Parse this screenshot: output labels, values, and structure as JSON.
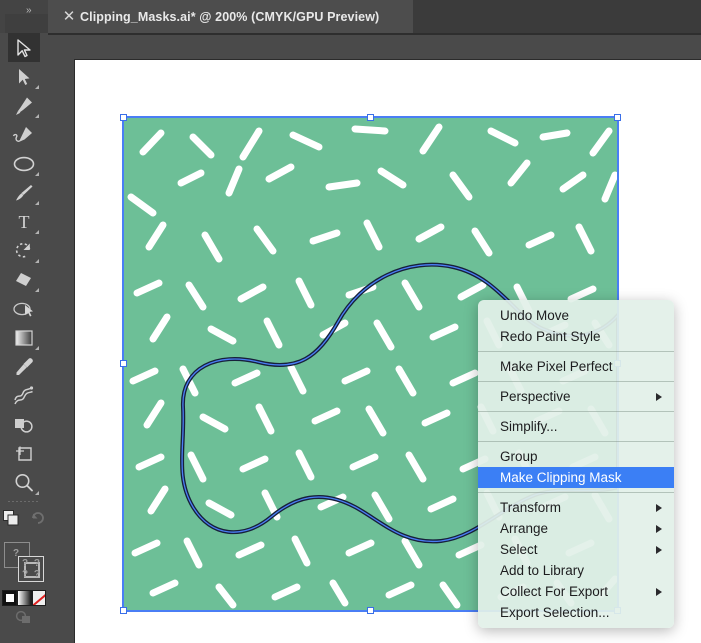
{
  "window": {
    "tab_close_icon": "close-icon",
    "tab_title": "Clipping_Masks.ai* @ 200% (CMYK/GPU Preview)",
    "panel_expand_icon": "»"
  },
  "toolbar": {
    "tools": [
      {
        "name": "selection-tool",
        "label": "Selection",
        "active": true,
        "has_flyout": false
      },
      {
        "name": "direct-selection-tool",
        "label": "Direct Selection",
        "active": false,
        "has_flyout": true
      },
      {
        "name": "pen-tool",
        "label": "Pen",
        "active": false,
        "has_flyout": true
      },
      {
        "name": "curvature-tool",
        "label": "Curvature",
        "active": false,
        "has_flyout": false
      },
      {
        "name": "ellipse-tool",
        "label": "Ellipse",
        "active": false,
        "has_flyout": true
      },
      {
        "name": "paintbrush-tool",
        "label": "Paintbrush",
        "active": false,
        "has_flyout": true
      },
      {
        "name": "type-tool",
        "label": "Type",
        "active": false,
        "has_flyout": true
      },
      {
        "name": "rotate-tool",
        "label": "Rotate",
        "active": false,
        "has_flyout": true
      },
      {
        "name": "eraser-tool",
        "label": "Eraser",
        "active": false,
        "has_flyout": true
      },
      {
        "name": "scale-shaper-tool",
        "label": "Shaper",
        "active": false,
        "has_flyout": false
      },
      {
        "name": "gradient-tool",
        "label": "Gradient",
        "active": false,
        "has_flyout": true
      },
      {
        "name": "eyedropper-tool",
        "label": "Eyedropper",
        "active": false,
        "has_flyout": false
      },
      {
        "name": "blend-tool",
        "label": "Blend",
        "active": false,
        "has_flyout": false
      },
      {
        "name": "shape-builder-tool",
        "label": "Shape Builder",
        "active": false,
        "has_flyout": false
      },
      {
        "name": "artboard-tool",
        "label": "Artboard",
        "active": false,
        "has_flyout": false
      },
      {
        "name": "zoom-tool",
        "label": "Zoom",
        "active": false,
        "has_flyout": true
      }
    ],
    "screen_mode_icon": "change-screen-mode-icon",
    "undo_icon": "undo-arrow-icon",
    "fill_label": "?",
    "stroke_label": "?",
    "color_modes": [
      "color",
      "gradient",
      "none"
    ],
    "drawing_mode_icon": "drawing-modes-icon"
  },
  "menu": {
    "items": [
      {
        "label": "Undo Move",
        "submenu": false,
        "selected": false,
        "separator_after": false
      },
      {
        "label": "Redo Paint Style",
        "submenu": false,
        "selected": false,
        "separator_after": true
      },
      {
        "label": "Make Pixel Perfect",
        "submenu": false,
        "selected": false,
        "separator_after": true
      },
      {
        "label": "Perspective",
        "submenu": true,
        "selected": false,
        "separator_after": true
      },
      {
        "label": "Simplify...",
        "submenu": false,
        "selected": false,
        "separator_after": true
      },
      {
        "label": "Group",
        "submenu": false,
        "selected": false,
        "separator_after": false
      },
      {
        "label": "Make Clipping Mask",
        "submenu": false,
        "selected": true,
        "separator_after": true
      },
      {
        "label": "Transform",
        "submenu": true,
        "selected": false,
        "separator_after": false
      },
      {
        "label": "Arrange",
        "submenu": true,
        "selected": false,
        "separator_after": false
      },
      {
        "label": "Select",
        "submenu": true,
        "selected": false,
        "separator_after": false
      },
      {
        "label": "Add to Library",
        "submenu": false,
        "selected": false,
        "separator_after": false
      },
      {
        "label": "Collect For Export",
        "submenu": true,
        "selected": false,
        "separator_after": false
      },
      {
        "label": "Export Selection...",
        "submenu": false,
        "selected": false,
        "separator_after": false
      }
    ]
  },
  "artwork": {
    "background_color": "#6dbf97",
    "dash_color": "#ffffff",
    "path_stroke_color": "#17203a",
    "selection_color": "#4a7ef5",
    "canvas_color": "#ffffff"
  },
  "colors": {
    "chrome_dark": "#3b3b3b",
    "chrome_mid": "#4a4a4a",
    "tab_active": "#4d4d4d",
    "menu_bg": "#e2f0e8",
    "menu_highlight": "#3b7ff5",
    "text_light": "#e9e9e9"
  }
}
